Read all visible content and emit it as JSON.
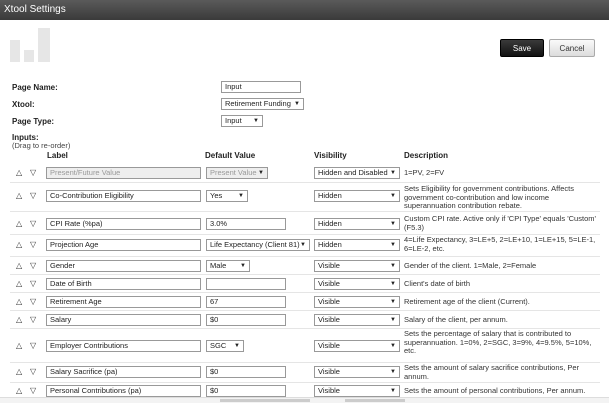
{
  "window": {
    "title": "Xtool Settings"
  },
  "toolbar": {
    "save_label": "Save",
    "cancel_label": "Cancel"
  },
  "form": {
    "page_name_label": "Page Name:",
    "page_name_value": "Input",
    "xtool_label": "Xtool:",
    "xtool_value": "Retirement Funding",
    "page_type_label": "Page Type:",
    "page_type_value": "Input"
  },
  "inputs": {
    "title": "Inputs:",
    "note": "(Drag to re-order)",
    "headers": {
      "label": "Label",
      "default": "Default Value",
      "visibility": "Visibility",
      "description": "Description"
    },
    "arrow_up": "△",
    "arrow_down": "▽",
    "rows": [
      {
        "label": "Present/Future Value",
        "default": "Present Value",
        "visibility": "Hidden and Disabled",
        "description": "1=PV, 2=FV"
      },
      {
        "label": "Co-Contribution Eligibility",
        "default": "Yes",
        "visibility": "Hidden",
        "description": "Sets Eligibility for government contributions. Affects government co-contribution and low income superannuation contribution rebate."
      },
      {
        "label": "CPI Rate (%pa)",
        "default": "3.0%",
        "visibility": "Hidden",
        "description": "Custom CPI rate. Active only if 'CPI Type' equals 'Custom' (F5.3)"
      },
      {
        "label": "Projection Age",
        "default": "Life Expectancy (Client 81)",
        "visibility": "Hidden",
        "description": "4=Life Expectancy, 3=LE+5, 2=LE+10, 1=LE+15, 5=LE-1, 6=LE-2, etc."
      },
      {
        "label": "Gender",
        "default": "Male",
        "visibility": "Visible",
        "description": "Gender of the client. 1=Male, 2=Female"
      },
      {
        "label": "Date of Birth",
        "default": "",
        "visibility": "Visible",
        "description": "Client's date of birth"
      },
      {
        "label": "Retirement Age",
        "default": "67",
        "visibility": "Visible",
        "description": "Retirement age of the client (Current)."
      },
      {
        "label": "Salary",
        "default": "$0",
        "visibility": "Visible",
        "description": "Salary of the client, per annum."
      },
      {
        "label": "Employer Contributions",
        "default": "SGC",
        "visibility": "Visible",
        "description": "Sets the percentage of salary that is contributed to superannuation. 1=0%, 2=SGC, 3=9%, 4=9.5%, 5=10%, etc."
      },
      {
        "label": "Salary Sacrifice (pa)",
        "default": "$0",
        "visibility": "Visible",
        "description": "Sets the amount of salary sacrifice contributions, Per annum."
      },
      {
        "label": "Personal Contributions (pa)",
        "default": "$0",
        "visibility": "Visible",
        "description": "Sets the amount of personal contributions, Per annum."
      }
    ]
  },
  "icons": {
    "logo": "bar-chart-logo-icon",
    "dropdown": "chevron-down-icon",
    "move_up": "move-up-icon",
    "move_down": "move-down-icon"
  }
}
